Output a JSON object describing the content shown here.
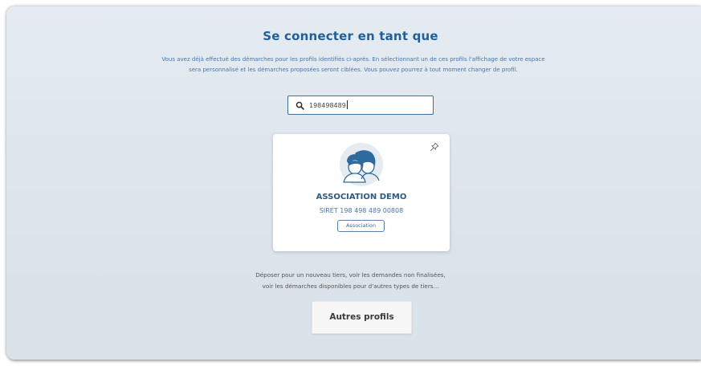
{
  "header": {
    "title": "Se connecter en tant que",
    "intro_line1": "Vous avez déjà effectué des démarches pour les profils identifiés ci-après. En sélectionnant un de ces profils l'affichage de votre espace",
    "intro_line2": "sera personnalisé et les démarches proposées seront ciblées. Vous pouvez pourrez à tout moment changer de profil."
  },
  "search": {
    "icon": "search-icon",
    "value": "198498489"
  },
  "profiles": [
    {
      "name": "ASSOCIATION DEMO",
      "siret": "SIRET 198 498 489 00808",
      "type": "Association",
      "avatar_icon": "people-avatar-icon",
      "pin_icon": "pin-icon"
    }
  ],
  "footer": {
    "text_line1": "Déposer pour un nouveau tiers, voir les demandes non finalisées,",
    "text_line2": "voir les démarches disponibles pour d'autres types de tiers...",
    "button_label": "Autres profils"
  },
  "colors": {
    "title": "#1f5f9e",
    "intro": "#4a76a8",
    "panel_bg": "#e1e8ef",
    "card_name": "#2c5a86",
    "avatar": "#2f6a9e"
  }
}
